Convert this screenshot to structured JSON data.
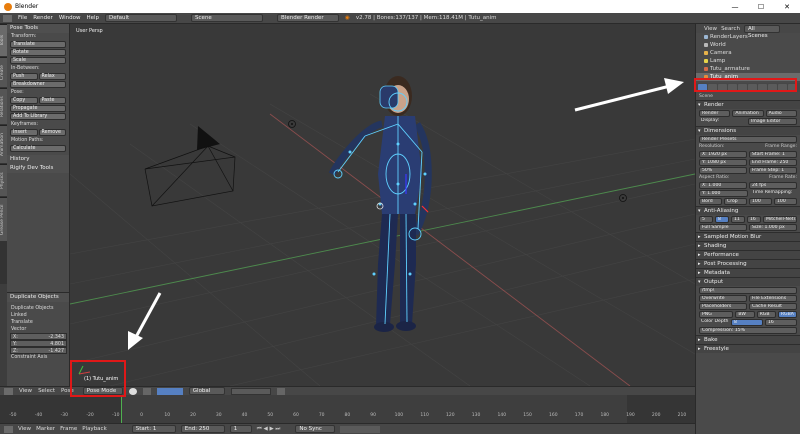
{
  "window": {
    "title": "Blender"
  },
  "infobar": {
    "menus": [
      "File",
      "Render",
      "Window",
      "Help"
    ],
    "layout": "Default",
    "scene": "Scene",
    "engine": "Blender Render",
    "stats": "v2.78 | Bones:137/137 | Mem:118.41M | Tutu_anim"
  },
  "tool_shelf": {
    "tabs": [
      "Tools",
      "Create",
      "Relations",
      "Animation",
      "Physics",
      "Grease Pencil"
    ],
    "title": "Pose Tools",
    "transform_label": "Transform:",
    "translate": "Translate",
    "rotate": "Rotate",
    "scale": "Scale",
    "inbetween_label": "In-Between:",
    "push": "Push",
    "relax": "Relax",
    "breakdowner": "Breakdowner",
    "pose_label": "Pose:",
    "copy": "Copy",
    "paste": "Paste",
    "propagate": "Propagate",
    "add_library": "Add To Library",
    "keyframes_label": "Keyframes:",
    "insert": "Insert",
    "remove": "Remove",
    "motion_label": "Motion Paths:",
    "calculate": "Calculate",
    "history": "History",
    "rigify": "Rigify Dev Tools"
  },
  "operator": {
    "title": "Duplicate Objects",
    "name": "Duplicate Objects",
    "linked": "Linked",
    "translate": "Translate",
    "vector": "Vector",
    "x": "X:",
    "xv": "-2.343",
    "y": "Y:",
    "yv": "4.801",
    "z": "Z:",
    "zv": "-1.427",
    "constraint": "Constraint Axis"
  },
  "viewport": {
    "label": "User Persp",
    "object_label": "(1) Tutu_anim"
  },
  "view3d_header": {
    "view": "View",
    "select": "Select",
    "pose": "Pose",
    "mode": "Pose Mode",
    "orientation": "Global"
  },
  "timeline": {
    "ticks": [
      "-50",
      "-40",
      "-30",
      "-20",
      "-10",
      "0",
      "10",
      "20",
      "30",
      "40",
      "50",
      "60",
      "70",
      "80",
      "90",
      "100",
      "110",
      "120",
      "130",
      "140",
      "150",
      "160",
      "170",
      "180",
      "190",
      "200",
      "210"
    ],
    "view": "View",
    "marker": "Marker",
    "frame": "Frame",
    "playback": "Playback",
    "start": "Start:",
    "start_v": "1",
    "end": "End:",
    "end_v": "250",
    "current": "1",
    "sync": "No Sync"
  },
  "outliner": {
    "view": "View",
    "search": "Search",
    "scope": "All Scenes",
    "items": [
      {
        "label": "RenderLayers",
        "color": "#9bb6d3"
      },
      {
        "label": "World",
        "color": "#b9b9b9"
      },
      {
        "label": "Camera",
        "color": "#e6b24a"
      },
      {
        "label": "Lamp",
        "color": "#e6d44a"
      },
      {
        "label": "Tutu_armature",
        "color": "#d26a4a"
      },
      {
        "label": "Tutu_anim",
        "color": "#e88a3a"
      }
    ]
  },
  "properties": {
    "scene": "Scene",
    "render": "Render",
    "render_btn": "Render",
    "animation_btn": "Animation",
    "audio_btn": "Audio",
    "display": "Display:",
    "display_v": "Image Editor",
    "dimensions": "Dimensions",
    "presets": "Render Presets",
    "resolution": "Resolution:",
    "res_x": "X:",
    "res_x_v": "1920 px",
    "res_y": "Y:",
    "res_y_v": "1080 px",
    "res_pct": "50%",
    "frame_range": "Frame Range:",
    "start_frame": "Start Frame:",
    "start_frame_v": "1",
    "end_frame": "End Frame:",
    "end_frame_v": "250",
    "frame_step": "Frame Step:",
    "frame_step_v": "1",
    "aspect": "Aspect Ratio:",
    "asp_x": "X:",
    "asp_x_v": "1.000",
    "asp_y": "Y:",
    "asp_y_v": "1.000",
    "frame_rate": "Frame Rate:",
    "fps": "24 fps",
    "time_remap": "Time Remapping:",
    "old": "100",
    "new": "100",
    "border": "Bord",
    "crop": "Crop",
    "aa": "Anti-Aliasing",
    "aa_samples": [
      "5",
      "8",
      "11",
      "16"
    ],
    "aa_filter": "Mitchell-Netravali",
    "full_sample": "Full Sample",
    "size": "Size:",
    "size_v": "1.000 px",
    "motion_blur": "Sampled Motion Blur",
    "shading": "Shading",
    "performance": "Performance",
    "post": "Post Processing",
    "metadata": "Metadata",
    "output": "Output",
    "output_path": "/tmp\\",
    "overwrite": "Overwrite",
    "file_ext": "File Extensions",
    "placeholders": "Placeholders",
    "cache": "Cache Result",
    "format": "PNG",
    "bw": "BW",
    "rgb": "RGB",
    "rgba": "RGBA",
    "color_depth": "Color Depth:",
    "depth8": "8",
    "depth16": "16",
    "compression": "Compression:",
    "compression_v": "15%",
    "bake": "Bake",
    "freestyle": "Freestyle"
  }
}
